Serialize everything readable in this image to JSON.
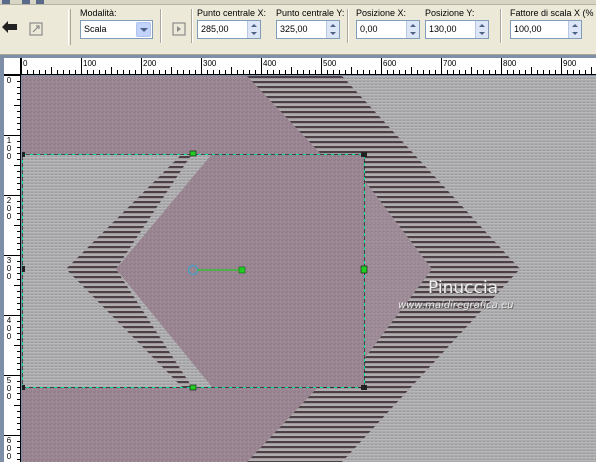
{
  "toolbar": {
    "mode_label": "Modalità:",
    "mode_value": "Scala",
    "center_x_label": "Punto centrale X:",
    "center_x_value": "285,00",
    "center_y_label": "Punto centrale Y:",
    "center_y_value": "325,00",
    "pos_x_label": "Posizione X:",
    "pos_x_value": "0,00",
    "pos_y_label": "Posizione Y:",
    "pos_y_value": "130,00",
    "scale_x_label": "Fattore di scala X (%",
    "scale_x_value": "100,00"
  },
  "ruler_h": {
    "labels": [
      "0",
      "100",
      "200",
      "300",
      "400",
      "500",
      "600",
      "700",
      "800",
      "900"
    ]
  },
  "ruler_v": {
    "labels": [
      "0",
      "100",
      "200",
      "300",
      "400",
      "500",
      "600"
    ]
  },
  "watermark": {
    "name": "Pinuccia",
    "url": "www.maidiregrafica.eu"
  },
  "colors": {
    "mauve": "#9a8592",
    "gray": "#a9a9ab",
    "stripe_dark": "#4a3b42",
    "selection_line": "#00ffaa",
    "handle": "#22cc22"
  }
}
